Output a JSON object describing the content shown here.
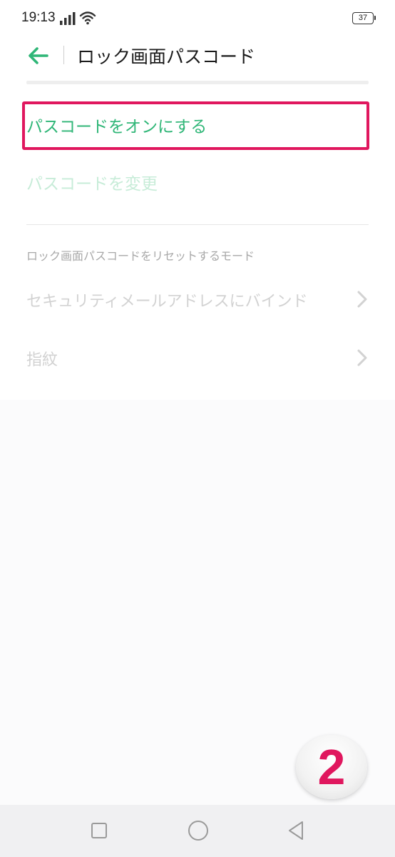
{
  "status_bar": {
    "time": "19:13",
    "battery": "37",
    "icons": [
      "signal-icon",
      "wifi-icon",
      "battery-icon"
    ]
  },
  "header": {
    "title": "ロック画面パスコード",
    "back_icon": "arrow-left-icon"
  },
  "items": {
    "turn_on_passcode": "パスコードをオンにする",
    "change_passcode": "パスコードを変更"
  },
  "reset_section": {
    "header": "ロック画面パスコードをリセットするモード",
    "items": [
      {
        "label": "セキュリティメールアドレスにバインド",
        "icon": "chevron-right-icon"
      },
      {
        "label": "指紋",
        "icon": "chevron-right-icon"
      }
    ]
  },
  "step_badge": "2",
  "nav_bar": {
    "icons": [
      "recents-square-icon",
      "home-circle-icon",
      "back-triangle-icon"
    ]
  },
  "colors": {
    "accent_green": "#2fb677",
    "disabled_green": "#c7ecd8",
    "highlight_pink": "#e0175e",
    "disabled_gray": "#d2d2d2"
  }
}
